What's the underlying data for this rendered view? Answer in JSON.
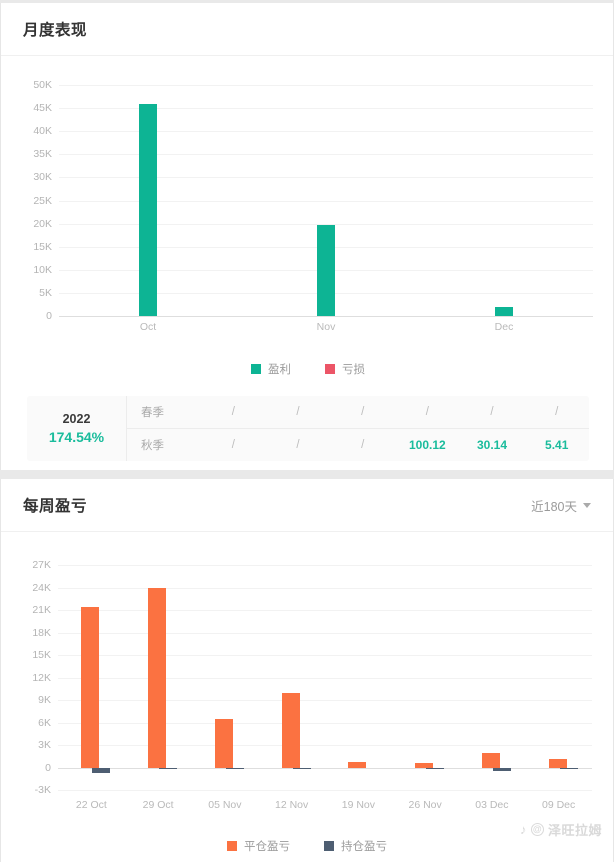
{
  "colors": {
    "profit_green": "#0DB494",
    "loss_red": "#EC5567",
    "closed_orange": "#FB7241",
    "open_navy": "#4E5E72",
    "accent_teal": "#1ABC9C"
  },
  "section1": {
    "title": "月度表现",
    "legend": [
      {
        "label": "盈利",
        "color": "#0DB494",
        "icon": "square-swatch-icon"
      },
      {
        "label": "亏损",
        "color": "#EC5567",
        "icon": "square-swatch-icon"
      }
    ],
    "table": {
      "year": "2022",
      "percent": "174.54%",
      "rows": [
        {
          "label": "春季",
          "cells": [
            "/",
            "/",
            "/",
            "/",
            "/",
            "/"
          ]
        },
        {
          "label": "秋季",
          "cells": [
            "/",
            "/",
            "/",
            "100.12",
            "30.14",
            "5.41"
          ]
        }
      ]
    }
  },
  "section2": {
    "title": "每周盈亏",
    "range_selector": {
      "label": "近180天",
      "icon": "chevron-down-icon"
    },
    "legend": [
      {
        "label": "平仓盈亏",
        "color": "#FB7241",
        "icon": "square-swatch-icon"
      },
      {
        "label": "持仓盈亏",
        "color": "#4E5E72",
        "icon": "square-swatch-icon"
      }
    ]
  },
  "watermark": {
    "handle": "泽旺拉姆",
    "at_icon": "at-circle-icon",
    "app_icon": "douyin-note-icon"
  },
  "chart_data": [
    {
      "id": "monthly-performance",
      "type": "bar",
      "title": "月度表现",
      "xlabel": "",
      "ylabel": "",
      "categories": [
        "Oct",
        "Nov",
        "Dec"
      ],
      "ylim": [
        0,
        50000
      ],
      "ytick_step": 5000,
      "ytick_labels": [
        "0",
        "5K",
        "10K",
        "15K",
        "20K",
        "25K",
        "30K",
        "35K",
        "40K",
        "45K",
        "50K"
      ],
      "ytick_values": [
        0,
        5000,
        10000,
        15000,
        20000,
        25000,
        30000,
        35000,
        40000,
        45000,
        50000
      ],
      "grid": true,
      "legend_position": "bottom",
      "series": [
        {
          "name": "盈利",
          "color": "#0DB494",
          "values": [
            45800,
            19600,
            2000
          ]
        },
        {
          "name": "亏损",
          "color": "#EC5567",
          "values": [
            0,
            0,
            0
          ]
        }
      ]
    },
    {
      "id": "weekly-pnl",
      "type": "bar",
      "title": "每周盈亏",
      "xlabel": "",
      "ylabel": "",
      "categories": [
        "22 Oct",
        "29 Oct",
        "05 Nov",
        "12 Nov",
        "19 Nov",
        "26 Nov",
        "03 Dec",
        "09 Dec"
      ],
      "ylim": [
        -3000,
        27000
      ],
      "ytick_step": 3000,
      "ytick_labels": [
        "-3K",
        "0",
        "3K",
        "6K",
        "9K",
        "12K",
        "15K",
        "18K",
        "21K",
        "24K",
        "27K"
      ],
      "ytick_values": [
        -3000,
        0,
        3000,
        6000,
        9000,
        12000,
        15000,
        18000,
        21000,
        24000,
        27000
      ],
      "grid": true,
      "legend_position": "bottom",
      "series": [
        {
          "name": "平仓盈亏",
          "color": "#FB7241",
          "values": [
            21400,
            24000,
            6500,
            10000,
            700,
            650,
            1900,
            1150
          ]
        },
        {
          "name": "持仓盈亏",
          "color": "#4E5E72",
          "values": [
            -700,
            -120,
            -40,
            -150,
            0,
            -120,
            -450,
            -90
          ]
        }
      ]
    }
  ]
}
